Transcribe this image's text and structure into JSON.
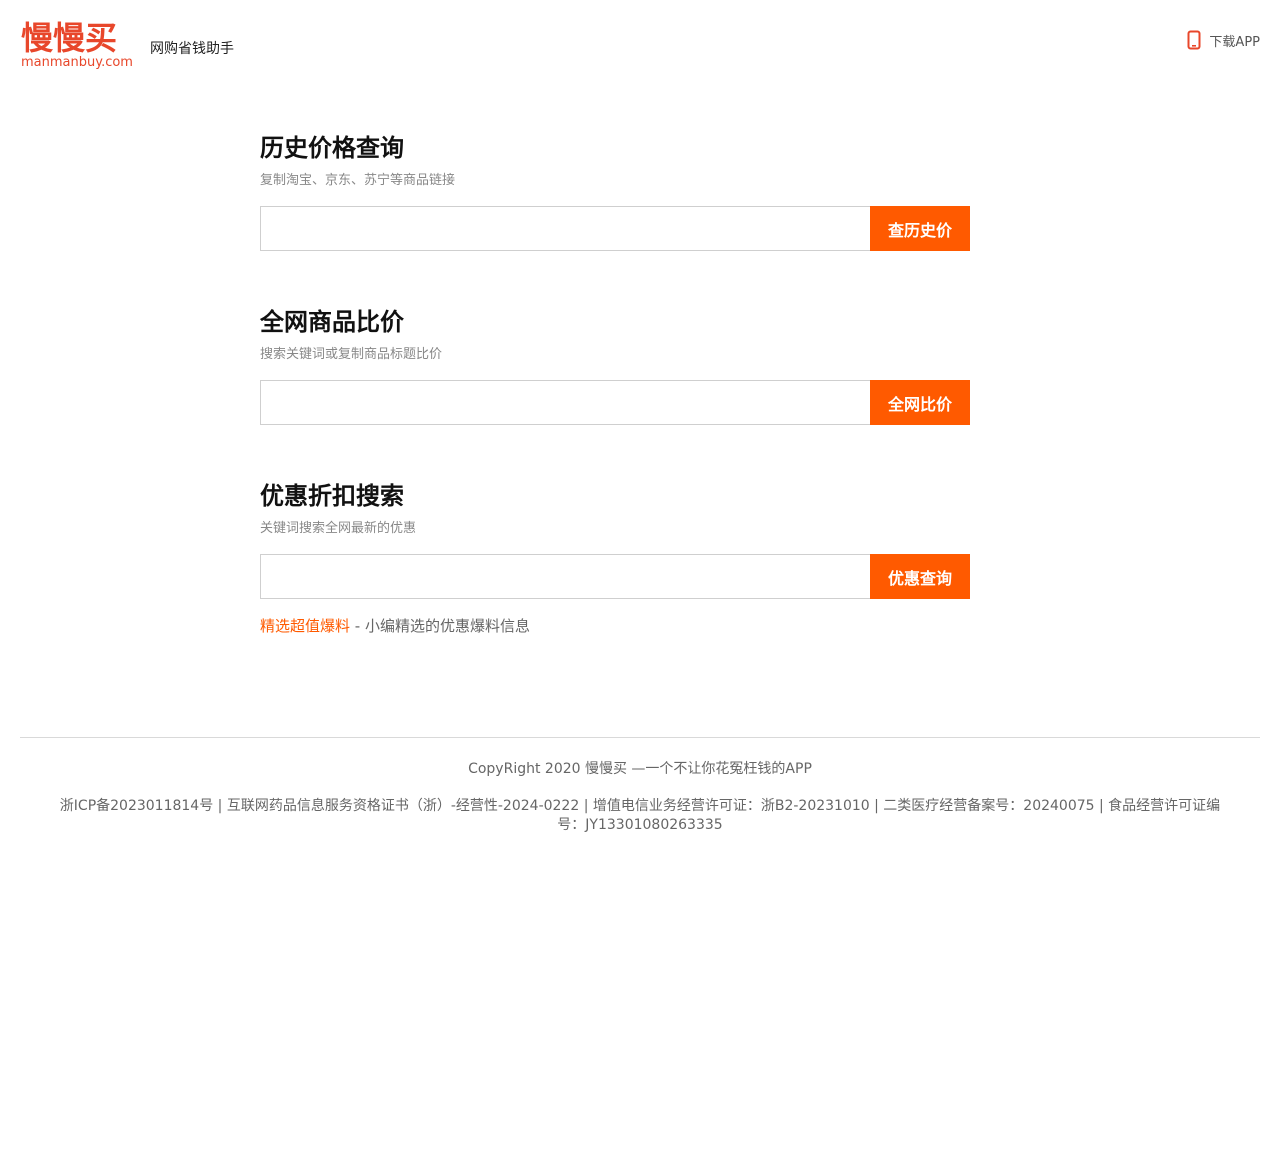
{
  "header": {
    "logo_text": "慢慢买",
    "logo_domain": "manmanbuy.com",
    "slogan": "网购省钱助手",
    "download_label": "下载APP",
    "download_icon": "phone-icon"
  },
  "colors": {
    "brand": "#e8472b",
    "accent": "#ff5a00"
  },
  "sections": [
    {
      "title": "历史价格查询",
      "desc": "复制淘宝、京东、苏宁等商品链接",
      "input_value": "",
      "button_label": "查历史价"
    },
    {
      "title": "全网商品比价",
      "desc": "搜索关键词或复制商品标题比价",
      "input_value": "",
      "button_label": "全网比价"
    },
    {
      "title": "优惠折扣搜索",
      "desc": "关键词搜索全网最新的优惠",
      "input_value": "",
      "button_label": "优惠查询"
    }
  ],
  "deals": {
    "link_label": "精选超值爆料",
    "separator": " - ",
    "desc": "小编精选的优惠爆料信息"
  },
  "footer": {
    "copyright": "CopyRight 2020 慢慢买 —一个不让你花冤枉钱的APP",
    "licenses": "浙ICP备2023011814号 | 互联网药品信息服务资格证书（浙）-经营性-2024-0222 | 增值电信业务经营许可证：浙B2-20231010 | 二类医疗经营备案号：20240075 | 食品经营许可证编号：JY13301080263335"
  }
}
